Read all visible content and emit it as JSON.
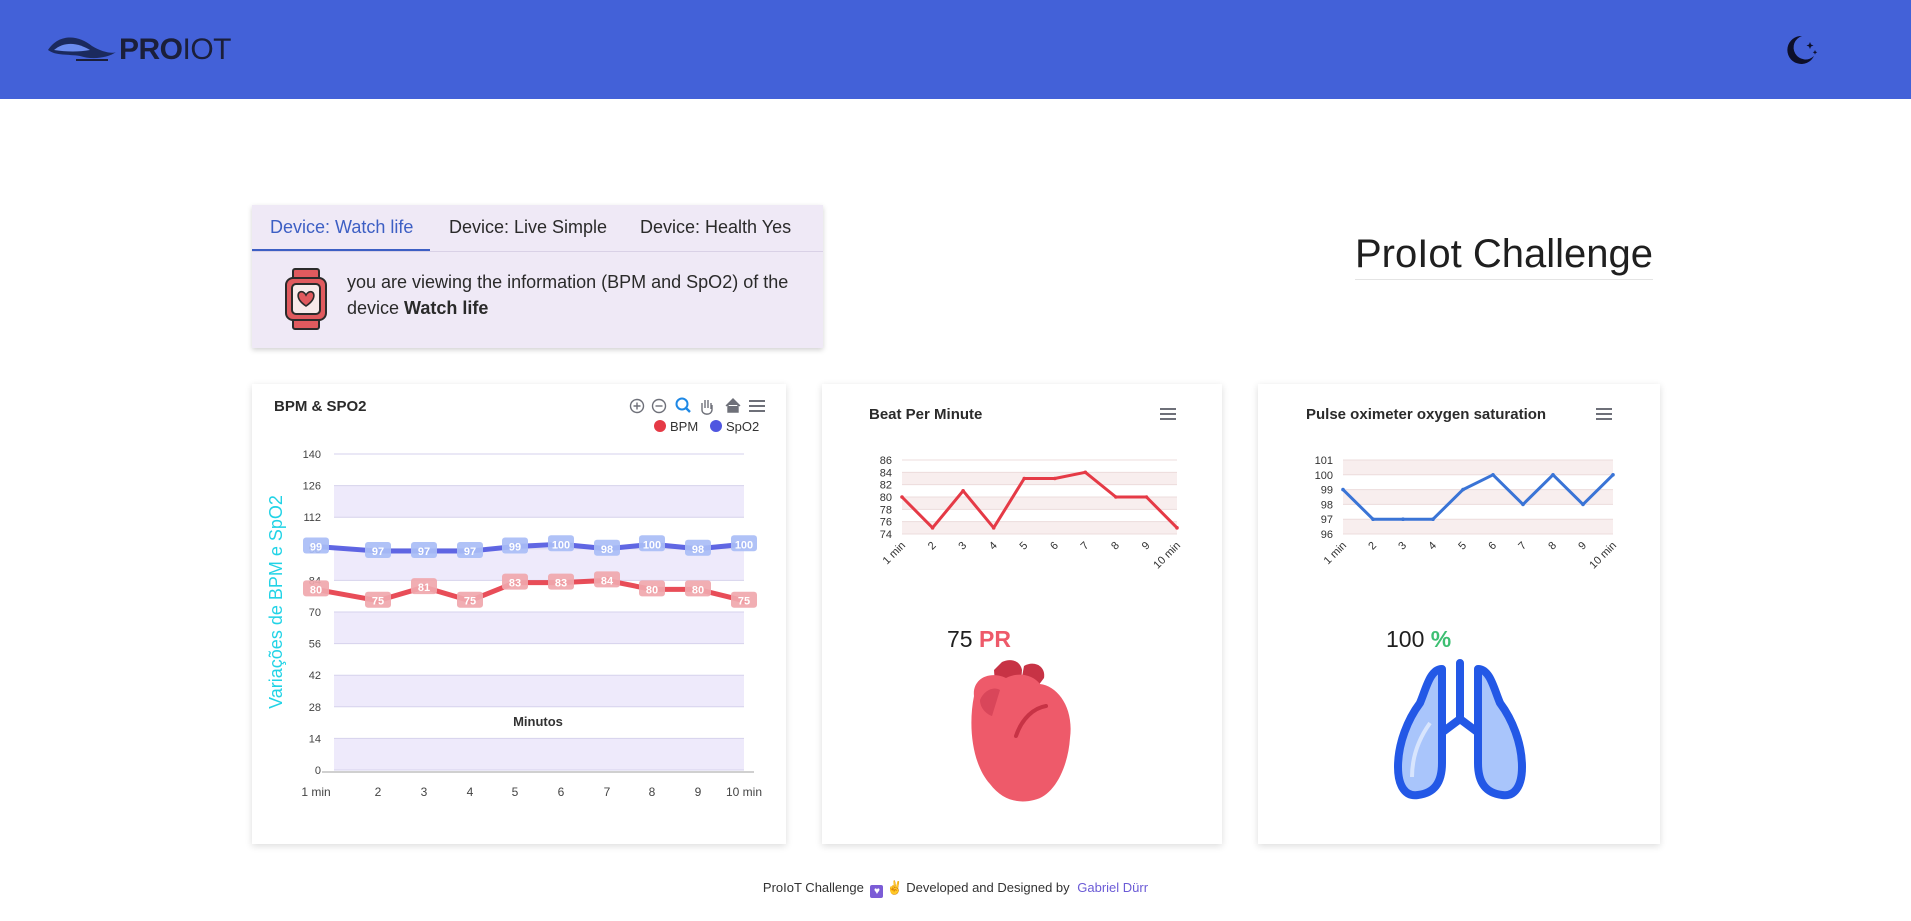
{
  "app": {
    "logo_bold": "PRO",
    "logo_light": "IOT"
  },
  "header": {
    "theme_toggle_icon": "moon-stars-icon"
  },
  "device_tabs": {
    "tabs": [
      "Device: Watch life",
      "Device: Live Simple",
      "Device: Health Yes"
    ],
    "active_index": 0,
    "message": "you are viewing the information (BPM and SpO2) of the device",
    "device_name": "Watch life",
    "icon": "smartwatch-heart-icon"
  },
  "page_title": "ProIot Challenge",
  "colors": {
    "header": "#4361d8",
    "bpm": "#e53a46",
    "spo2": "#4f56e0",
    "spo2_line": "#3a74d6",
    "pr_label": "#ee5a6a",
    "percent_label": "#3dbf72",
    "axis_title": "#22d3e6"
  },
  "main_chart": {
    "toolbar_icons": [
      "zoom-in-icon",
      "zoom-out-icon",
      "zoom-selection-icon",
      "pan-icon",
      "reset-home-icon",
      "menu-icon"
    ]
  },
  "bpm_card": {
    "value": "75",
    "unit": "PR",
    "icon": "heart-icon",
    "menu_icon": "menu-icon"
  },
  "spo2_card": {
    "value": "100",
    "unit": "%",
    "icon": "lungs-icon",
    "menu_icon": "menu-icon"
  },
  "chart_data": [
    {
      "type": "line",
      "title": "BPM & SPO2",
      "x": [
        "1 min",
        "2",
        "3",
        "4",
        "5",
        "6",
        "7",
        "8",
        "9",
        "10 min"
      ],
      "series": [
        {
          "name": "BPM",
          "values": [
            80,
            75,
            81,
            75,
            83,
            83,
            84,
            80,
            80,
            75
          ]
        },
        {
          "name": "SpO2",
          "values": [
            99,
            97,
            97,
            97,
            99,
            100,
            98,
            100,
            98,
            100
          ]
        }
      ],
      "xlabel": "Minutos",
      "ylabel": "Variações de BPM e SpO2",
      "ylim": [
        0,
        140
      ],
      "yticks": [
        0,
        14,
        28,
        42,
        56,
        70,
        84,
        98,
        112,
        126,
        140
      ],
      "legend": "top-right",
      "grid": true,
      "data_labels": true
    },
    {
      "type": "line",
      "title": "Beat Per Minute",
      "x": [
        "1 min",
        "2",
        "3",
        "4",
        "5",
        "6",
        "7",
        "8",
        "9",
        "10 min"
      ],
      "series": [
        {
          "values": [
            80,
            75,
            81,
            75,
            83,
            83,
            84,
            80,
            80,
            75
          ]
        }
      ],
      "ylim": [
        74,
        86
      ],
      "yticks": [
        74,
        76,
        78,
        80,
        82,
        84,
        86
      ],
      "grid": true
    },
    {
      "type": "line",
      "title": "Pulse oximeter oxygen saturation",
      "x": [
        "1 min",
        "2",
        "3",
        "4",
        "5",
        "6",
        "7",
        "8",
        "9",
        "10 min"
      ],
      "series": [
        {
          "values": [
            99,
            97,
            97,
            97,
            99,
            100,
            98,
            100,
            98,
            100
          ]
        }
      ],
      "ylim": [
        96,
        101
      ],
      "yticks": [
        96,
        97,
        98,
        99,
        100,
        101
      ],
      "grid": true
    }
  ],
  "footer": {
    "text_before": "ProIoT Challenge",
    "emoji_text": "Developed and Designed by",
    "author": "Gabriel Dürr"
  }
}
